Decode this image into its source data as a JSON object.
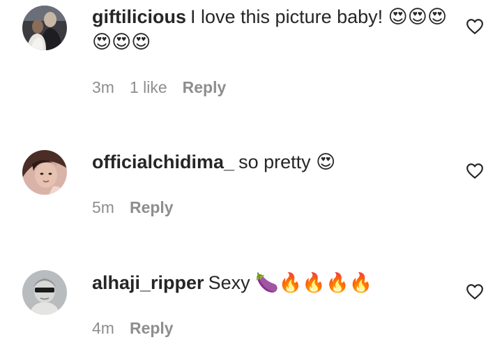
{
  "comments": [
    {
      "username": "giftilicious",
      "message": "I love this picture baby! 😍😍😍😍😍😍",
      "time": "3m",
      "likes": "1 like",
      "reply": "Reply",
      "avatar_icon": "avatar-photo-couple",
      "like_icon": "heart-outline-icon"
    },
    {
      "username": "officialchidima_",
      "message": "so pretty 😍",
      "time": "5m",
      "reply": "Reply",
      "avatar_icon": "avatar-photo-woman",
      "like_icon": "heart-outline-icon"
    },
    {
      "username": "alhaji_ripper",
      "message": "Sexy 🍆🔥🔥🔥🔥",
      "time": "4m",
      "reply": "Reply",
      "avatar_icon": "avatar-photo-man-sunglasses",
      "like_icon": "heart-outline-icon"
    }
  ],
  "colors": {
    "primary_text": "#262626",
    "secondary_text": "#8e8e8e",
    "background": "#ffffff"
  }
}
